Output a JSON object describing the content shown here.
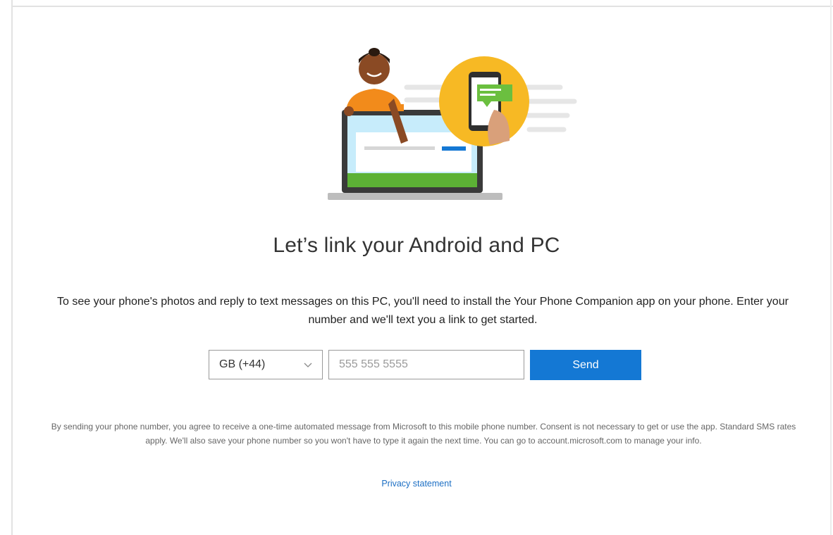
{
  "page": {
    "title": "Let’s link your Android and PC",
    "description": "To see your phone's photos and reply to text messages on this PC, you'll need to install the Your Phone Companion app on your phone. Enter your number and we'll text you a link to get started."
  },
  "form": {
    "country_value": "GB (+44)",
    "phone_placeholder": "555 555 5555",
    "phone_value": "",
    "send_label": "Send"
  },
  "footer": {
    "disclaimer": "By sending your phone number, you agree to receive a one-time automated message from Microsoft to this mobile phone number.  Consent is not necessary to get or use the app.  Standard SMS rates apply. We'll also save your phone number so you won't have to type it again the next time. You can go to account.microsoft.com to manage your info.",
    "privacy_label": "Privacy statement"
  },
  "colors": {
    "accent": "#1478d4",
    "link": "#1c6fc4",
    "illustration_circle": "#f7b924",
    "person_shirt": "#f28b1b",
    "laptop_grass": "#5cb135",
    "message_bubble": "#6bbf3f"
  },
  "icons": {
    "select_chevron": "chevron-down-icon",
    "hero": "person-laptop-phone-illustration"
  }
}
